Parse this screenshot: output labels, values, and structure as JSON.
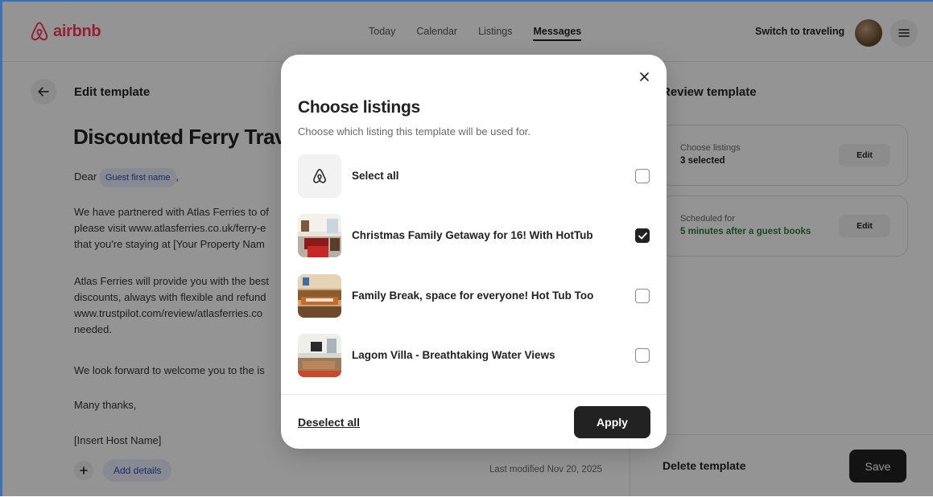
{
  "header": {
    "brand": "airbnb",
    "nav": [
      "Today",
      "Calendar",
      "Listings",
      "Messages"
    ],
    "active_nav": "Messages",
    "switch_label": "Switch to traveling"
  },
  "editor": {
    "section_title": "Edit template",
    "template_title": "Discounted Ferry Trav",
    "greeting_prefix": "Dear",
    "greeting_chip": "Guest first name",
    "greeting_suffix": ",",
    "paragraph1": [
      "We have partnered with Atlas Ferries to of",
      "please visit www.atlasferries.co.uk/ferry-e",
      "that you're staying at [Your Property Nam"
    ],
    "paragraph2": [
      "Atlas Ferries will provide you with the best",
      "discounts, always with flexible and refund",
      "www.trustpilot.com/review/atlasferries.co",
      "needed."
    ],
    "paragraph3": "We look forward to welcome you to the is",
    "signoff": "Many thanks,",
    "host_name": "[Insert Host Name]",
    "add_details": "Add details",
    "last_modified": "Last modified Nov 20, 2025"
  },
  "review": {
    "title": "Review template",
    "listings_label": "Choose listings",
    "listings_value": "3 selected",
    "schedule_label": "Scheduled for",
    "schedule_value": "5 minutes after a guest books",
    "edit_label": "Edit",
    "delete_label": "Delete template",
    "save_label": "Save"
  },
  "modal": {
    "title": "Choose listings",
    "subtitle": "Choose which listing this template will be used for.",
    "select_all": "Select all",
    "listings": [
      {
        "name": "Christmas Family Getaway for 16! With HotTub",
        "checked": true
      },
      {
        "name": "Family Break, space for everyone! Hot Tub Too",
        "checked": false
      },
      {
        "name": "Lagom Villa - Breathtaking Water Views",
        "checked": false
      }
    ],
    "deselect_all": "Deselect all",
    "apply": "Apply"
  },
  "colors": {
    "brand": "#ff385c",
    "chip_bg": "#e8eefc",
    "chip_text": "#2b4eaa",
    "green": "#2e7d32",
    "dark_button": "#222222"
  }
}
